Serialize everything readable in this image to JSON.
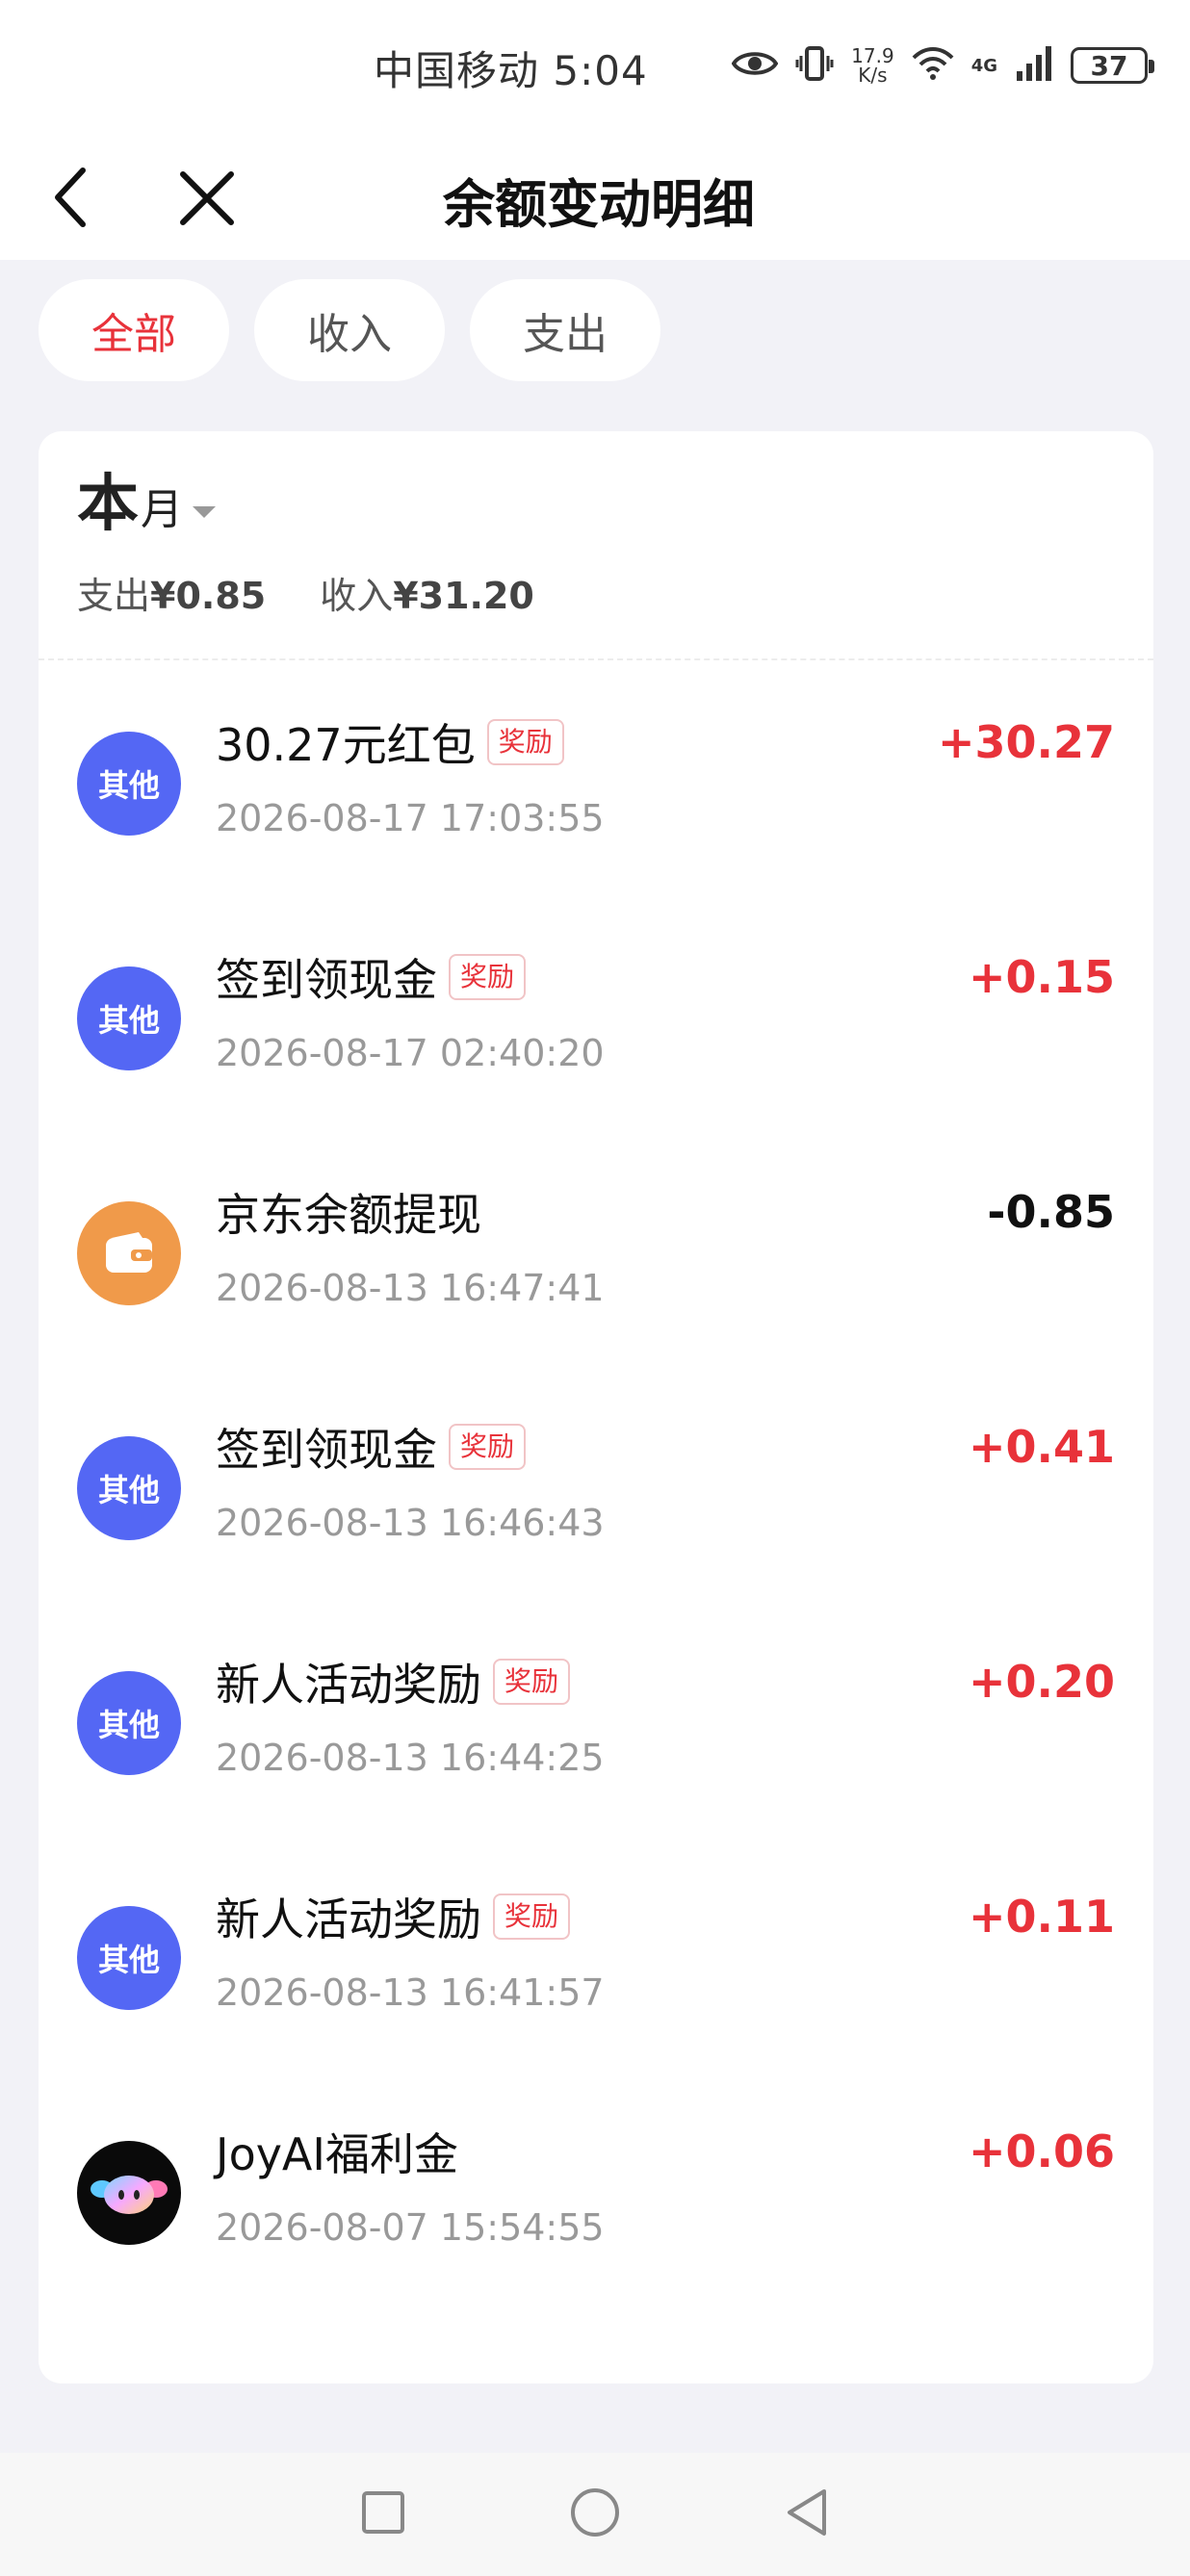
{
  "status_bar": {
    "carrier_time": "中国移动 5:04",
    "net_speed_value": "17.9",
    "net_speed_unit": "K/s",
    "network_type": "4G",
    "battery": "37"
  },
  "nav": {
    "title": "余额变动明细"
  },
  "filters": {
    "all": "全部",
    "income": "收入",
    "expense": "支出",
    "active": "全部"
  },
  "period": {
    "big": "本",
    "small": "月"
  },
  "summary": {
    "expense_label": "支出",
    "expense_value": "¥0.85",
    "income_label": "收入",
    "income_value": "¥31.20"
  },
  "transactions": [
    {
      "avatar_text": "其他",
      "avatar_icon": "other-category-icon",
      "title": "30.27元红包",
      "badge": "奖励",
      "time": "2026-08-17 17:03:55",
      "amount": "+30.27"
    },
    {
      "avatar_text": "其他",
      "avatar_icon": "other-category-icon",
      "title": "签到领现金",
      "badge": "奖励",
      "time": "2026-08-17 02:40:20",
      "amount": "+0.15"
    },
    {
      "avatar_text": "",
      "avatar_icon": "wallet-icon",
      "title": "京东余额提现",
      "badge": "",
      "time": "2026-08-13 16:47:41",
      "amount": "-0.85"
    },
    {
      "avatar_text": "其他",
      "avatar_icon": "other-category-icon",
      "title": "签到领现金",
      "badge": "奖励",
      "time": "2026-08-13 16:46:43",
      "amount": "+0.41"
    },
    {
      "avatar_text": "其他",
      "avatar_icon": "other-category-icon",
      "title": "新人活动奖励",
      "badge": "奖励",
      "time": "2026-08-13 16:44:25",
      "amount": "+0.20"
    },
    {
      "avatar_text": "其他",
      "avatar_icon": "other-category-icon",
      "title": "新人活动奖励",
      "badge": "奖励",
      "time": "2026-08-13 16:41:57",
      "amount": "+0.11"
    },
    {
      "avatar_text": "",
      "avatar_icon": "joyai-logo-icon",
      "title": "JoyAI福利金",
      "badge": "",
      "time": "2026-08-07 15:54:55",
      "amount": "+0.06"
    }
  ],
  "colors": {
    "accent_red": "#e8323a",
    "avatar_blue": "#5467f4",
    "avatar_orange": "#f09a4a"
  }
}
